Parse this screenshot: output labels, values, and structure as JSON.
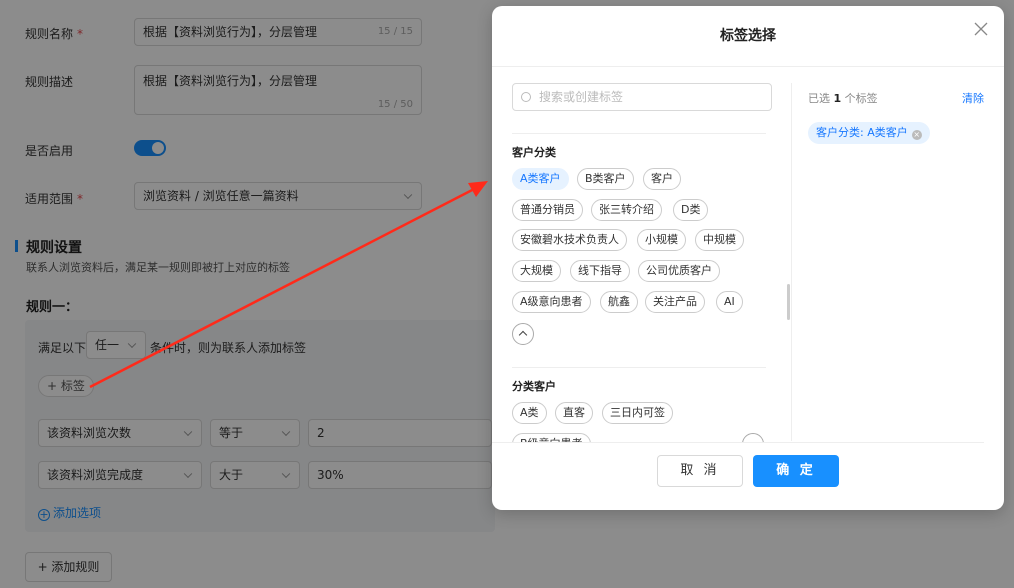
{
  "form": {
    "rule_name_label": "规则名称",
    "rule_name_value": "根据【资料浏览行为】，分层管理",
    "rule_name_counter": "15 / 15",
    "rule_desc_label": "规则描述",
    "rule_desc_value": "根据【资料浏览行为】，分层管理",
    "rule_desc_counter": "15 / 50",
    "enabled_label": "是否启用",
    "scope_label": "适用范围",
    "scope_value": "浏览资料 / 浏览任意一篇资料",
    "required_mark": "*",
    "section_title": "规则设置",
    "section_desc": "联系人浏览资料后，满足某一规则即被打上对应的标签",
    "rule_one_title": "规则一：",
    "cond_prefix": "满足以下",
    "cond_select": "任一",
    "cond_suffix": "条件时，则为联系人添加标签",
    "add_tag_button": "+ 标签",
    "rows": [
      {
        "field": "该资料浏览次数",
        "op": "等于",
        "value": "2"
      },
      {
        "field": "该资料浏览完成度",
        "op": "大于",
        "value": "30%"
      }
    ],
    "add_option": "添加选项",
    "add_rule": "+ 添加规则"
  },
  "modal": {
    "title": "标签选择",
    "search_placeholder": "搜索或创建标签",
    "groups": [
      {
        "title": "客户分类",
        "tags": [
          "A类客户",
          "B类客户",
          "客户",
          "普通分销员",
          "张三转介绍",
          "D类",
          "安徽碧水技术负责人",
          "小规模",
          "中规模",
          "大规模",
          "线下指导",
          "公司优质客户",
          "A级意向患者",
          "航鑫",
          "关注产品",
          "AI"
        ]
      },
      {
        "title": "分类客户",
        "tags": [
          "A类",
          "直客",
          "三日内可签",
          "B级意向患者"
        ]
      }
    ],
    "selected_prefix": "已选",
    "selected_count": "1",
    "selected_suffix": "个标签",
    "clear_label": "清除",
    "selected_chip": "客户分类: A类客户",
    "cancel_label": "取 消",
    "ok_label": "确 定"
  },
  "colors": {
    "accent": "#1890ff",
    "selected_chip_bg": "#e6f2ff",
    "annotation_arrow": "#ff2a1a"
  },
  "icons": [
    "close-icon",
    "search-icon",
    "chevron-up-icon",
    "plus-circle-icon",
    "chevron-down-icon"
  ]
}
